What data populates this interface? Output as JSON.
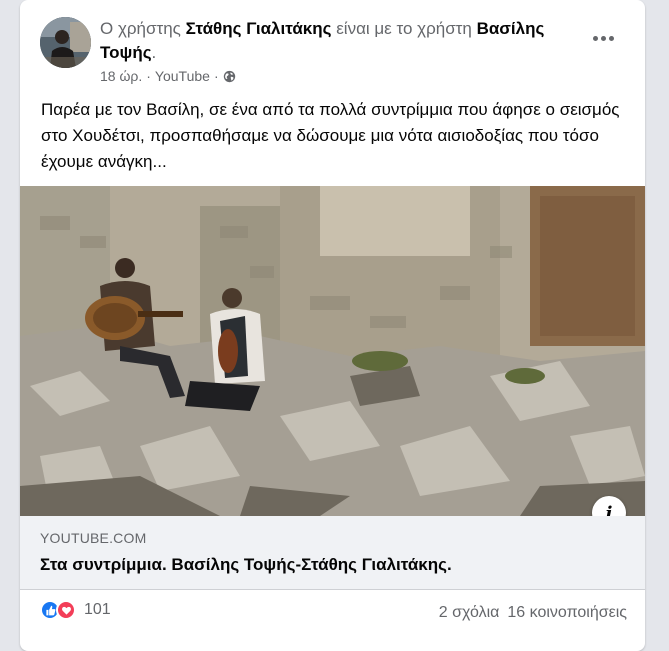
{
  "post": {
    "prefix": "Ο χρήστης ",
    "author": "Στάθης Γιαλιτάκης",
    "middle": " είναι με το χρήστη ",
    "tagged": "Βασίλης Τοψής",
    "suffix": ".",
    "time": "18 ώρ.",
    "separator": " · ",
    "source": "YouTube",
    "body": "Παρέα με τον Βασίλη, σε ένα από τα πολλά συντρίμμια που άφησε ο σεισμός στο Χουδέτσι, προσπαθήσαμε να δώσουμε μια νότα αισιοδοξίας που τόσο έχουμε ανάγκη..."
  },
  "link_preview": {
    "domain": "YOUTUBE.COM",
    "title": "Στα συντρίμμια. Βασίλης Τοψής-Στάθης Γιαλιτάκης.",
    "info_icon": "i"
  },
  "footer": {
    "reaction_count": "101",
    "comments": "2 σχόλια",
    "shares": "16 κοινοποιήσεις"
  },
  "colors": {
    "like": "#1877f2",
    "love": "#f33e58",
    "muted_text": "#65676b"
  }
}
